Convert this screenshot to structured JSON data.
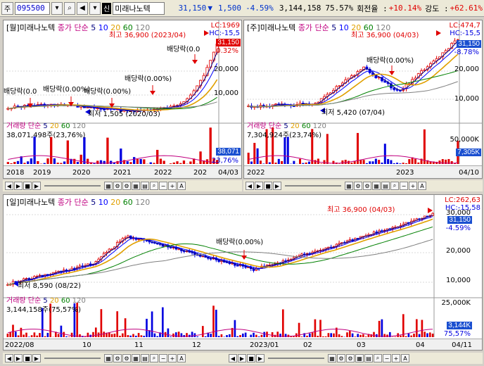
{
  "toolbar": {
    "mode": "주",
    "code": "095500",
    "badge": "신",
    "stock_name": "미래나노텍",
    "price": "31,150",
    "change": "1,500",
    "change_pct": "-4.59%",
    "volume": "3,144,158",
    "volume_ratio": "75.57%",
    "turnover_label": "회전율 :",
    "turnover": "+10.14%",
    "strength_label": "강도 :",
    "strength": "+62.61%"
  },
  "monthly": {
    "title": "[월]미래나노텍",
    "ma_label": "종가 단순",
    "ma": [
      "5",
      "10",
      "20",
      "60",
      "120"
    ],
    "lc": "LC:1969",
    "hc": "HC:-15,5",
    "high_ann": "최고 36,900 (2023/04)",
    "low_ann": "최저 1,505 (2020/03)",
    "div1": "배당락(0.0",
    "div2": "배당락(0.00%)",
    "div3": "배당락(0.00%)",
    "div4": "배당락(0.00%)",
    "div5": "배당락(0.0",
    "price_box": "31,150",
    "pct_box": "0.32%",
    "y_ticks": [
      "20,000",
      "10,000"
    ],
    "vol_title": "거래량 단순",
    "vol_ma": [
      "5",
      "20",
      "60",
      "120"
    ],
    "vol_value": "38,071,498주(23,76%)",
    "vol_box": "38,071",
    "vol_pct": "23,76%",
    "x_ticks": [
      "2018",
      "2019",
      "2020",
      "2021",
      "2022",
      "202"
    ],
    "date_box": "04/03"
  },
  "weekly": {
    "title": "[주]미래나노텍",
    "ma_label": "종가 단순",
    "ma": [
      "5",
      "10",
      "20",
      "60",
      "120"
    ],
    "lc": "LC:474,7",
    "hc": "HC:-15,5",
    "high_ann": "최고 36,900 (04/03)",
    "low_ann": "최저 5,420 (07/04)",
    "div1": "배당락(0.00%)",
    "price_box": "31,150",
    "pct_box": "-8.78%",
    "y_ticks": [
      "20,000",
      "10,000"
    ],
    "vol_title": "거래량 단순",
    "vol_ma": [
      "5",
      "20",
      "60",
      "120"
    ],
    "vol_value": "7,304,924주(23,74%)",
    "vol_box": "7,305K",
    "vol_y_tick": "50,000K",
    "x_ticks": [
      "2022",
      "2023"
    ],
    "date_box": "04/10"
  },
  "daily": {
    "title": "[일]미래나노텍",
    "ma_label": "종가 단순",
    "ma": [
      "5",
      "10",
      "20",
      "60",
      "120"
    ],
    "lc": "LC:262,63",
    "hc": "HC:-15,58",
    "high_ann": "최고 36,900 (04/03)",
    "low_ann": "최저 8,590 (08/22)",
    "div1": "배당락(0.00%)",
    "price_box": "31,150",
    "pct_box": "-4.59%",
    "y_ticks": [
      "30,000",
      "20,000",
      "10,000"
    ],
    "vol_title": "거래량 단순",
    "vol_ma": [
      "5",
      "20",
      "60",
      "120"
    ],
    "vol_value": "3,144,158주(75,57%)",
    "vol_box": "3,144K",
    "vol_pct": "75,57%",
    "vol_y_tick": "25,000K",
    "x_ticks": [
      "2022/08",
      "10",
      "11",
      "12",
      "2023/01",
      "02",
      "03",
      "04"
    ],
    "date_box": "04/11"
  },
  "colors": {
    "up": "#e00000",
    "down": "#0000e0",
    "ma5": "#000080",
    "ma10": "#0000ff",
    "ma20": "#e0a000",
    "ma60": "#008000",
    "ma120": "#808080",
    "price_box_bg": "#e00000",
    "price_box_blue": "#1a4fd0"
  }
}
